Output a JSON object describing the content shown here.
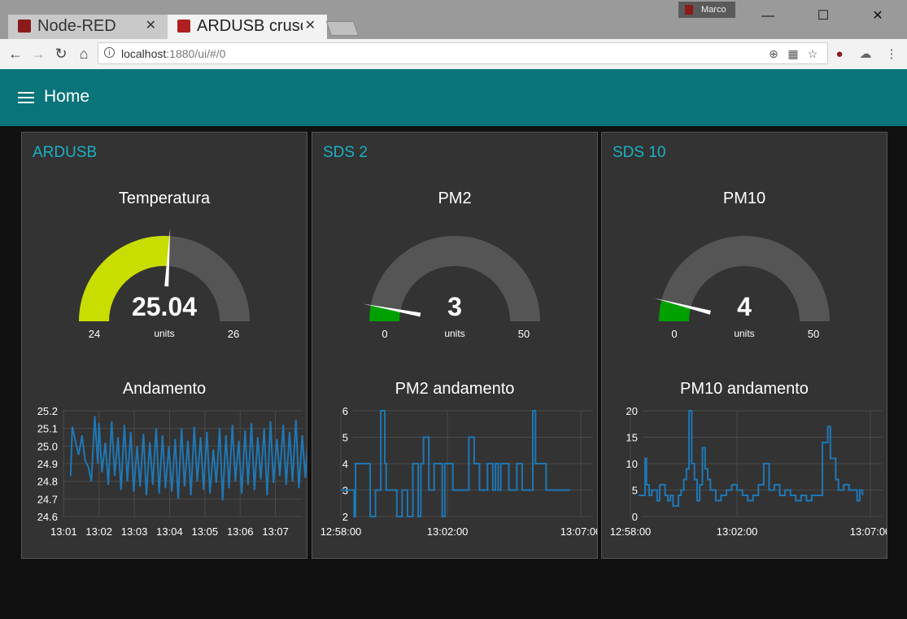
{
  "browser": {
    "tabs": [
      {
        "label": "Node-RED"
      },
      {
        "label": "ARDUSB crusc"
      }
    ],
    "profile_name": "Marco",
    "url_host": "localhost",
    "url_path": ":1880/ui/#/0"
  },
  "app": {
    "title": "Home"
  },
  "groups": [
    {
      "title": "ARDUSB",
      "gauge": {
        "title": "Temperatura",
        "value": "25.04",
        "units": "units",
        "min": "24",
        "max": "26",
        "fraction": 0.52,
        "color": "#c8dd00"
      },
      "chart_title": "Andamento"
    },
    {
      "title": "SDS 2",
      "gauge": {
        "title": "PM2",
        "value": "3",
        "units": "units",
        "min": "0",
        "max": "50",
        "fraction": 0.06,
        "color": "#00a000"
      },
      "chart_title": "PM2 andamento"
    },
    {
      "title": "SDS 10",
      "gauge": {
        "title": "PM10",
        "value": "4",
        "units": "units",
        "min": "0",
        "max": "50",
        "fraction": 0.08,
        "color": "#00a000"
      },
      "chart_title": "PM10 andamento"
    }
  ],
  "chart_data": [
    {
      "type": "line",
      "title": "Andamento",
      "x_ticks": [
        "13:01",
        "13:02",
        "13:03",
        "13:04",
        "13:05",
        "13:06",
        "13:07"
      ],
      "y_ticks": [
        "25.2",
        "25.1",
        "25.0",
        "24.9",
        "24.8",
        "24.7",
        "24.6"
      ],
      "ylim": [
        24.6,
        25.2
      ],
      "series": [
        {
          "x": [
            13.033,
            13.037,
            13.045,
            13.052,
            13.06,
            13.067,
            13.075,
            13.082,
            13.09,
            13.097,
            13.1,
            13.107,
            13.115,
            13.122,
            13.13,
            13.137,
            13.145,
            13.152,
            13.16,
            13.167,
            13.175,
            13.182,
            13.19,
            13.197,
            13.205,
            13.212,
            13.22,
            13.227,
            13.235,
            13.242,
            13.25,
            13.257,
            13.265,
            13.272,
            13.28,
            13.287,
            13.295,
            13.302,
            13.31,
            13.317,
            13.325,
            13.332,
            13.34,
            13.347,
            13.355,
            13.362,
            13.37,
            13.377,
            13.385,
            13.392,
            13.4,
            13.407,
            13.415,
            13.422,
            13.43,
            13.437,
            13.445,
            13.452,
            13.46,
            13.467,
            13.475,
            13.482,
            13.49,
            13.497,
            13.505,
            13.512,
            13.52,
            13.527,
            13.535,
            13.542,
            13.55,
            13.557,
            13.565,
            13.572,
            13.58,
            13.587,
            13.595,
            13.602,
            13.61,
            13.617,
            13.625,
            13.632,
            13.64,
            13.647,
            13.655,
            13.662,
            13.67,
            13.677,
            13.685,
            13.692,
            13.7,
            13.707,
            13.715,
            13.722,
            13.73,
            13.737,
            13.745,
            13.752,
            13.76,
            13.767,
            13.775,
            13.782,
            13.79,
            13.797,
            13.805,
            13.812,
            13.82,
            13.827,
            13.835,
            13.842,
            13.85,
            13.857,
            13.865,
            13.872,
            13.88,
            13.887,
            13.895,
            13.902,
            13.91
          ],
          "y": [
            24.83,
            25.11,
            25.02,
            24.95,
            25.06,
            24.92,
            24.88,
            24.8,
            25.17,
            24.9,
            25.13,
            24.85,
            25.02,
            24.78,
            25.14,
            24.83,
            25.05,
            24.75,
            25.12,
            24.8,
            25.08,
            24.74,
            25.0,
            24.77,
            25.07,
            24.72,
            25.02,
            24.78,
            25.1,
            24.73,
            25.06,
            24.76,
            25.0,
            24.74,
            25.04,
            24.7,
            25.1,
            24.77,
            25.03,
            24.72,
            25.11,
            24.8,
            25.05,
            24.75,
            25.08,
            24.73,
            24.98,
            24.79,
            25.1,
            24.69,
            25.06,
            24.76,
            25.12,
            24.8,
            25.03,
            24.73,
            25.09,
            24.78,
            25.13,
            24.75,
            25.05,
            24.81,
            25.1,
            24.72,
            25.14,
            24.79,
            25.04,
            24.83,
            25.12,
            24.78,
            25.08,
            24.8,
            25.15,
            24.76,
            25.06,
            24.82,
            25.1,
            24.78,
            25.12,
            24.79,
            25.03,
            24.8,
            25.11,
            24.77,
            25.13,
            24.82,
            25.0,
            24.79,
            25.1,
            24.8,
            25.04,
            24.78,
            25.12,
            24.81,
            24.98,
            24.79,
            25.04,
            24.8,
            25.08,
            24.78,
            25.02,
            24.82,
            25.1,
            24.79,
            25.06,
            24.8,
            25.0,
            24.78,
            25.05,
            24.83,
            25.03,
            24.79,
            25.08,
            24.78,
            25.0,
            24.8,
            25.04,
            24.79,
            25.04
          ]
        }
      ]
    },
    {
      "type": "line",
      "title": "PM2 andamento",
      "x_ticks": [
        "12:58:00",
        "13:02:00",
        "13:07:00"
      ],
      "y_ticks": [
        "6",
        "5",
        "4",
        "3",
        "2"
      ],
      "ylim": [
        2,
        6
      ],
      "xlim_minutes": [
        0,
        9
      ],
      "series": [
        {
          "x": [
            0,
            0.45,
            0.5,
            0.55,
            0.6,
            0.65,
            0.75,
            1.0,
            1.1,
            1.3,
            1.5,
            1.55,
            1.65,
            1.7,
            1.8,
            2.0,
            2.1,
            2.3,
            2.4,
            2.5,
            2.7,
            2.8,
            2.9,
            3.0,
            3.1,
            3.3,
            3.5,
            3.6,
            3.7,
            3.8,
            3.9,
            4.0,
            4.2,
            4.3,
            4.4,
            4.7,
            4.8,
            4.9,
            5.0,
            5.2,
            5.4,
            5.5,
            5.6,
            5.7,
            5.8,
            5.9,
            6.0,
            6.2,
            6.3,
            6.5,
            6.6,
            6.7,
            6.8,
            6.9,
            7.1,
            7.2,
            7.3,
            7.4,
            7.5,
            7.6,
            7.7,
            7.8,
            8.0,
            8.2,
            8.4,
            8.6
          ],
          "y": [
            3,
            3,
            2,
            4,
            4,
            4,
            4,
            4,
            2,
            3,
            6,
            6,
            4,
            3,
            3,
            3,
            2,
            3,
            3,
            2,
            4,
            4,
            2,
            4,
            5,
            3,
            4,
            4,
            4,
            2,
            4,
            4,
            3,
            3,
            3,
            3,
            5,
            5,
            4,
            3,
            3,
            4,
            4,
            3,
            4,
            3,
            4,
            4,
            3,
            3,
            4,
            4,
            3,
            3,
            3,
            6,
            4,
            4,
            4,
            4,
            3,
            3,
            3,
            3,
            3,
            3
          ]
        }
      ]
    },
    {
      "type": "line",
      "title": "PM10 andamento",
      "x_ticks": [
        "12:58:00",
        "13:02:00",
        "13:07:00"
      ],
      "y_ticks": [
        "20",
        "15",
        "10",
        "5",
        "0"
      ],
      "ylim": [
        0,
        20
      ],
      "xlim_minutes": [
        0,
        9
      ],
      "series": [
        {
          "x": [
            0.3,
            0.5,
            0.55,
            0.6,
            0.7,
            0.8,
            0.9,
            1.0,
            1.1,
            1.2,
            1.3,
            1.4,
            1.5,
            1.6,
            1.8,
            1.9,
            2.0,
            2.1,
            2.2,
            2.3,
            2.4,
            2.5,
            2.6,
            2.7,
            2.8,
            2.9,
            3.0,
            3.2,
            3.4,
            3.6,
            3.8,
            4.0,
            4.2,
            4.4,
            4.6,
            4.8,
            5.0,
            5.2,
            5.4,
            5.6,
            5.8,
            6.0,
            6.2,
            6.4,
            6.6,
            6.8,
            7.0,
            7.2,
            7.4,
            7.5,
            7.6,
            7.7,
            7.8,
            7.9,
            8.0,
            8.2,
            8.4,
            8.5,
            8.6,
            8.7
          ],
          "y": [
            4,
            4,
            11,
            6,
            4,
            5,
            5,
            3,
            6,
            6,
            4,
            3,
            4,
            2,
            4,
            5,
            7,
            9,
            20,
            10,
            7,
            3,
            6,
            13,
            9,
            7,
            5,
            3,
            4,
            5,
            6,
            5,
            4,
            3,
            4,
            6,
            10,
            5,
            6,
            4,
            5,
            4,
            3,
            4,
            3,
            4,
            4,
            14,
            17,
            11,
            11,
            7,
            5,
            5,
            6,
            5,
            5,
            3,
            5,
            4
          ]
        }
      ]
    }
  ]
}
